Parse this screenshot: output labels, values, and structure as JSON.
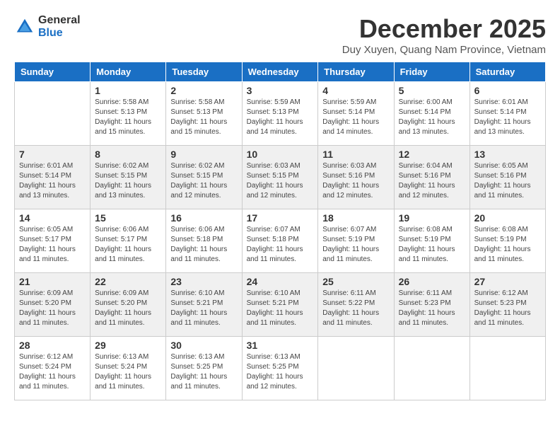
{
  "logo": {
    "general": "General",
    "blue": "Blue"
  },
  "title": "December 2025",
  "location": "Duy Xuyen, Quang Nam Province, Vietnam",
  "weekdays": [
    "Sunday",
    "Monday",
    "Tuesday",
    "Wednesday",
    "Thursday",
    "Friday",
    "Saturday"
  ],
  "weeks": [
    [
      {
        "day": "",
        "info": ""
      },
      {
        "day": "1",
        "info": "Sunrise: 5:58 AM\nSunset: 5:13 PM\nDaylight: 11 hours\nand 15 minutes."
      },
      {
        "day": "2",
        "info": "Sunrise: 5:58 AM\nSunset: 5:13 PM\nDaylight: 11 hours\nand 15 minutes."
      },
      {
        "day": "3",
        "info": "Sunrise: 5:59 AM\nSunset: 5:13 PM\nDaylight: 11 hours\nand 14 minutes."
      },
      {
        "day": "4",
        "info": "Sunrise: 5:59 AM\nSunset: 5:14 PM\nDaylight: 11 hours\nand 14 minutes."
      },
      {
        "day": "5",
        "info": "Sunrise: 6:00 AM\nSunset: 5:14 PM\nDaylight: 11 hours\nand 13 minutes."
      },
      {
        "day": "6",
        "info": "Sunrise: 6:01 AM\nSunset: 5:14 PM\nDaylight: 11 hours\nand 13 minutes."
      }
    ],
    [
      {
        "day": "7",
        "info": "Sunrise: 6:01 AM\nSunset: 5:14 PM\nDaylight: 11 hours\nand 13 minutes."
      },
      {
        "day": "8",
        "info": "Sunrise: 6:02 AM\nSunset: 5:15 PM\nDaylight: 11 hours\nand 13 minutes."
      },
      {
        "day": "9",
        "info": "Sunrise: 6:02 AM\nSunset: 5:15 PM\nDaylight: 11 hours\nand 12 minutes."
      },
      {
        "day": "10",
        "info": "Sunrise: 6:03 AM\nSunset: 5:15 PM\nDaylight: 11 hours\nand 12 minutes."
      },
      {
        "day": "11",
        "info": "Sunrise: 6:03 AM\nSunset: 5:16 PM\nDaylight: 11 hours\nand 12 minutes."
      },
      {
        "day": "12",
        "info": "Sunrise: 6:04 AM\nSunset: 5:16 PM\nDaylight: 11 hours\nand 12 minutes."
      },
      {
        "day": "13",
        "info": "Sunrise: 6:05 AM\nSunset: 5:16 PM\nDaylight: 11 hours\nand 11 minutes."
      }
    ],
    [
      {
        "day": "14",
        "info": "Sunrise: 6:05 AM\nSunset: 5:17 PM\nDaylight: 11 hours\nand 11 minutes."
      },
      {
        "day": "15",
        "info": "Sunrise: 6:06 AM\nSunset: 5:17 PM\nDaylight: 11 hours\nand 11 minutes."
      },
      {
        "day": "16",
        "info": "Sunrise: 6:06 AM\nSunset: 5:18 PM\nDaylight: 11 hours\nand 11 minutes."
      },
      {
        "day": "17",
        "info": "Sunrise: 6:07 AM\nSunset: 5:18 PM\nDaylight: 11 hours\nand 11 minutes."
      },
      {
        "day": "18",
        "info": "Sunrise: 6:07 AM\nSunset: 5:19 PM\nDaylight: 11 hours\nand 11 minutes."
      },
      {
        "day": "19",
        "info": "Sunrise: 6:08 AM\nSunset: 5:19 PM\nDaylight: 11 hours\nand 11 minutes."
      },
      {
        "day": "20",
        "info": "Sunrise: 6:08 AM\nSunset: 5:19 PM\nDaylight: 11 hours\nand 11 minutes."
      }
    ],
    [
      {
        "day": "21",
        "info": "Sunrise: 6:09 AM\nSunset: 5:20 PM\nDaylight: 11 hours\nand 11 minutes."
      },
      {
        "day": "22",
        "info": "Sunrise: 6:09 AM\nSunset: 5:20 PM\nDaylight: 11 hours\nand 11 minutes."
      },
      {
        "day": "23",
        "info": "Sunrise: 6:10 AM\nSunset: 5:21 PM\nDaylight: 11 hours\nand 11 minutes."
      },
      {
        "day": "24",
        "info": "Sunrise: 6:10 AM\nSunset: 5:21 PM\nDaylight: 11 hours\nand 11 minutes."
      },
      {
        "day": "25",
        "info": "Sunrise: 6:11 AM\nSunset: 5:22 PM\nDaylight: 11 hours\nand 11 minutes."
      },
      {
        "day": "26",
        "info": "Sunrise: 6:11 AM\nSunset: 5:23 PM\nDaylight: 11 hours\nand 11 minutes."
      },
      {
        "day": "27",
        "info": "Sunrise: 6:12 AM\nSunset: 5:23 PM\nDaylight: 11 hours\nand 11 minutes."
      }
    ],
    [
      {
        "day": "28",
        "info": "Sunrise: 6:12 AM\nSunset: 5:24 PM\nDaylight: 11 hours\nand 11 minutes."
      },
      {
        "day": "29",
        "info": "Sunrise: 6:13 AM\nSunset: 5:24 PM\nDaylight: 11 hours\nand 11 minutes."
      },
      {
        "day": "30",
        "info": "Sunrise: 6:13 AM\nSunset: 5:25 PM\nDaylight: 11 hours\nand 11 minutes."
      },
      {
        "day": "31",
        "info": "Sunrise: 6:13 AM\nSunset: 5:25 PM\nDaylight: 11 hours\nand 12 minutes."
      },
      {
        "day": "",
        "info": ""
      },
      {
        "day": "",
        "info": ""
      },
      {
        "day": "",
        "info": ""
      }
    ]
  ]
}
